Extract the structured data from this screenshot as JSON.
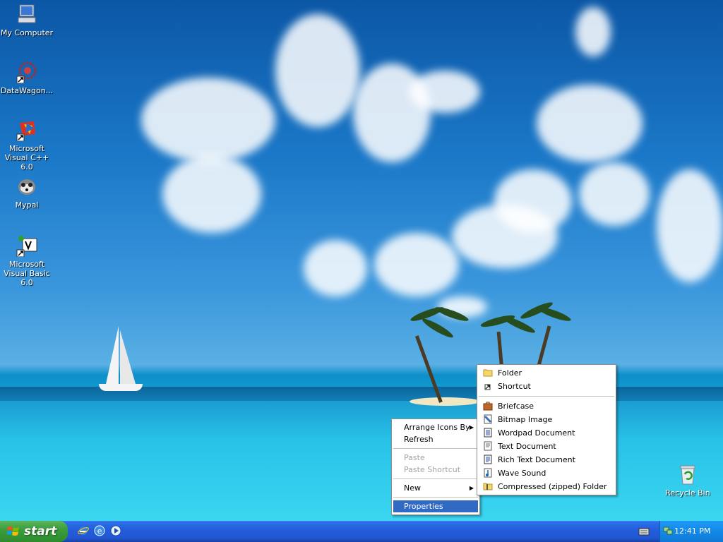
{
  "desktop": {
    "icons": [
      {
        "label": "My Computer",
        "icon": "my-computer-icon"
      },
      {
        "label": "DataWagon...",
        "icon": "datawagon-icon"
      },
      {
        "label": "Microsoft Visual C++ 6.0",
        "icon": "visual-cpp-icon"
      },
      {
        "label": "Mypal",
        "icon": "mypal-icon"
      },
      {
        "label": "Microsoft Visual Basic 6.0",
        "icon": "visual-basic-icon"
      },
      {
        "label": "Recycle Bin",
        "icon": "recycle-bin-icon"
      }
    ]
  },
  "context_menu": {
    "arrange": "Arrange Icons By",
    "refresh": "Refresh",
    "paste": "Paste",
    "paste_shortcut": "Paste Shortcut",
    "new": "New",
    "properties": "Properties"
  },
  "new_submenu": {
    "folder": "Folder",
    "shortcut": "Shortcut",
    "briefcase": "Briefcase",
    "bitmap": "Bitmap Image",
    "wordpad": "Wordpad Document",
    "text": "Text Document",
    "rtf": "Rich Text Document",
    "wave": "Wave Sound",
    "zip": "Compressed (zipped) Folder"
  },
  "taskbar": {
    "start_label": "start",
    "clock": "12:41 PM"
  },
  "colors": {
    "selection": "#316ac5",
    "taskbar": "#245edb",
    "start_button": "#3c9e3c"
  }
}
